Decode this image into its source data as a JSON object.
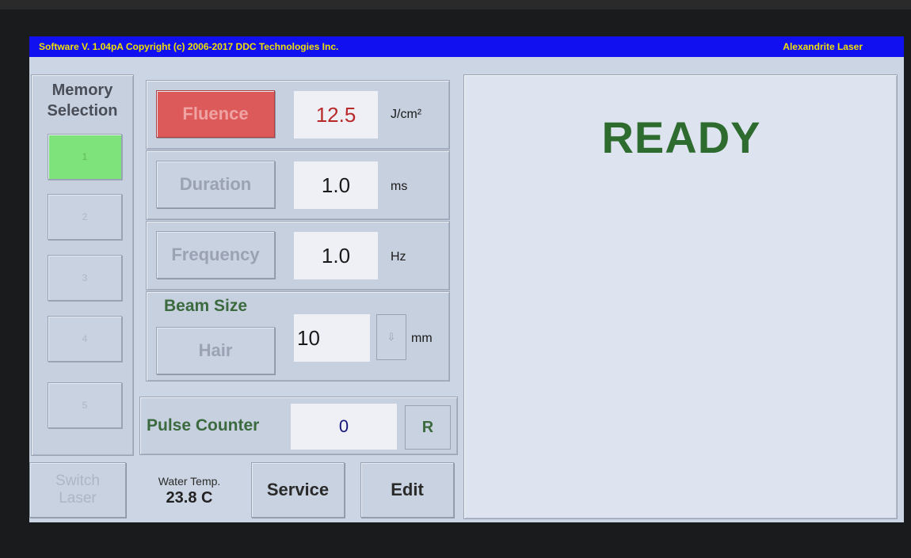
{
  "titlebar": {
    "left_text": "Software V. 1.04pA   Copyright (c) 2006-2017 DDC Technologies Inc.",
    "right_text": "Alexandrite Laser"
  },
  "memory": {
    "title_line1": "Memory",
    "title_line2": "Selection",
    "slots": [
      "1",
      "2",
      "3",
      "4",
      "5"
    ],
    "active_slot": "1"
  },
  "params": {
    "fluence": {
      "label": "Fluence",
      "value": "12.5",
      "unit": "J/cm²"
    },
    "duration": {
      "label": "Duration",
      "value": "1.0",
      "unit": "ms"
    },
    "frequency": {
      "label": "Frequency",
      "value": "1.0",
      "unit": "Hz"
    },
    "beam": {
      "title": "Beam Size",
      "mode_label": "Hair",
      "value": "10",
      "unit": "mm",
      "arrow": "⇩"
    }
  },
  "pulse_counter": {
    "label": "Pulse Counter",
    "value": "0",
    "reset_label": "R"
  },
  "bottom": {
    "switch_line1": "Switch",
    "switch_line2": "Laser",
    "water_label": "Water Temp.",
    "water_value": "23.8 C",
    "service_label": "Service",
    "edit_label": "Edit"
  },
  "status": {
    "text": "READY",
    "color": "#2e6b2e"
  },
  "colors": {
    "titlebar_bg": "#1010f0",
    "titlebar_text": "#f0e000",
    "active_slot": "#7ee37a",
    "fluence_button": "#dd5a5a"
  }
}
